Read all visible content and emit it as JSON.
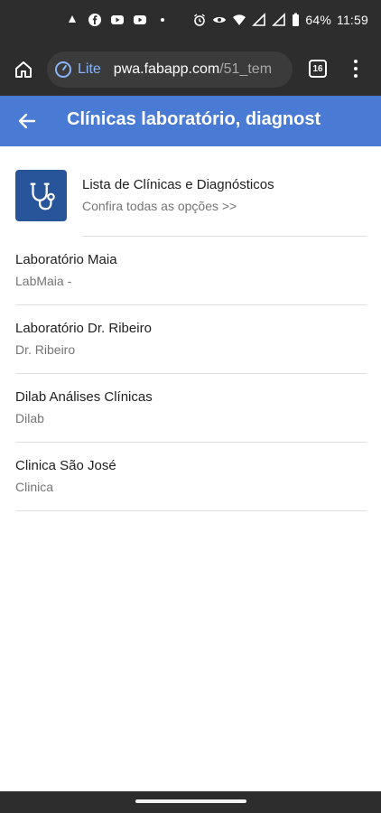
{
  "status_bar": {
    "battery": "64%",
    "time": "11:59"
  },
  "browser": {
    "lite_label": "Lite",
    "url_host": "pwa.fabapp.com",
    "url_path": "/51_tem",
    "tab_count": "16"
  },
  "header": {
    "title": "Clínicas laboratório, diagnost"
  },
  "featured": {
    "title": "Lista de Clínicas e Diagnósticos",
    "subtitle": "Confira todas as opções >>"
  },
  "items": [
    {
      "title": "Laboratório Maia",
      "subtitle": "LabMaia -"
    },
    {
      "title": "Laboratório Dr. Ribeiro",
      "subtitle": "Dr. Ribeiro"
    },
    {
      "title": "Dilab Análises Clínicas",
      "subtitle": "Dilab"
    },
    {
      "title": "Clinica São José",
      "subtitle": "Clinica"
    }
  ],
  "colors": {
    "app_bar": "#4a7bd4",
    "feature_icon_bg": "#28549a",
    "system_bar": "#2d2d2d",
    "lite_accent": "#8ab4f8"
  },
  "icons": {
    "back": "arrow-left-icon",
    "home": "home-icon",
    "lite": "lite-mode-icon",
    "menu": "more-vertical-icon",
    "featured": "stethoscope-icon"
  }
}
